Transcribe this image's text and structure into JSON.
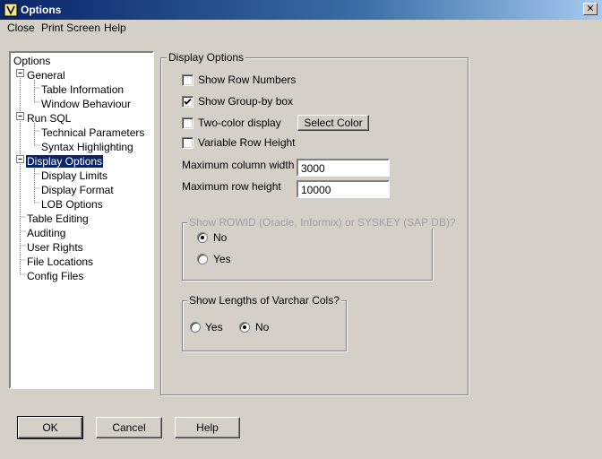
{
  "window": {
    "title": "Options",
    "close_glyph": "✕"
  },
  "menu": [
    "Close",
    "Print Screen",
    "Help"
  ],
  "tree": {
    "root": "Options",
    "nodes": [
      "General",
      "Table Information",
      "Window Behaviour",
      "Run SQL",
      "Technical Parameters",
      "Syntax Highlighting",
      "Display Options",
      "Display Limits",
      "Display Format",
      "LOB Options",
      "Table Editing",
      "Auditing",
      "User Rights",
      "File Locations",
      "Config Files"
    ],
    "selected": "Display Options"
  },
  "panel": {
    "title": "Display Options",
    "show_row_numbers": {
      "label": "Show Row Numbers",
      "checked": false
    },
    "show_group_by": {
      "label": "Show Group-by box",
      "checked": true
    },
    "two_color": {
      "label": "Two-color display",
      "checked": false
    },
    "select_color": "Select Color",
    "variable_row_height": {
      "label": "Variable Row Height",
      "checked": false
    },
    "max_col_width": {
      "label": "Maximum column width",
      "value": "3000"
    },
    "max_row_height": {
      "label": "Maximum row height",
      "value": "10000"
    },
    "rowid_group": {
      "title": "Show ROWID (Oracle, Informix) or SYSKEY (SAP DB)?",
      "enabled": false,
      "options": [
        "No",
        "Yes"
      ],
      "selected": "No"
    },
    "varchar_group": {
      "title": "Show Lengths of Varchar Cols?",
      "options": [
        "Yes",
        "No"
      ],
      "selected": "No"
    }
  },
  "buttons": {
    "ok": "OK",
    "cancel": "Cancel",
    "help": "Help"
  }
}
